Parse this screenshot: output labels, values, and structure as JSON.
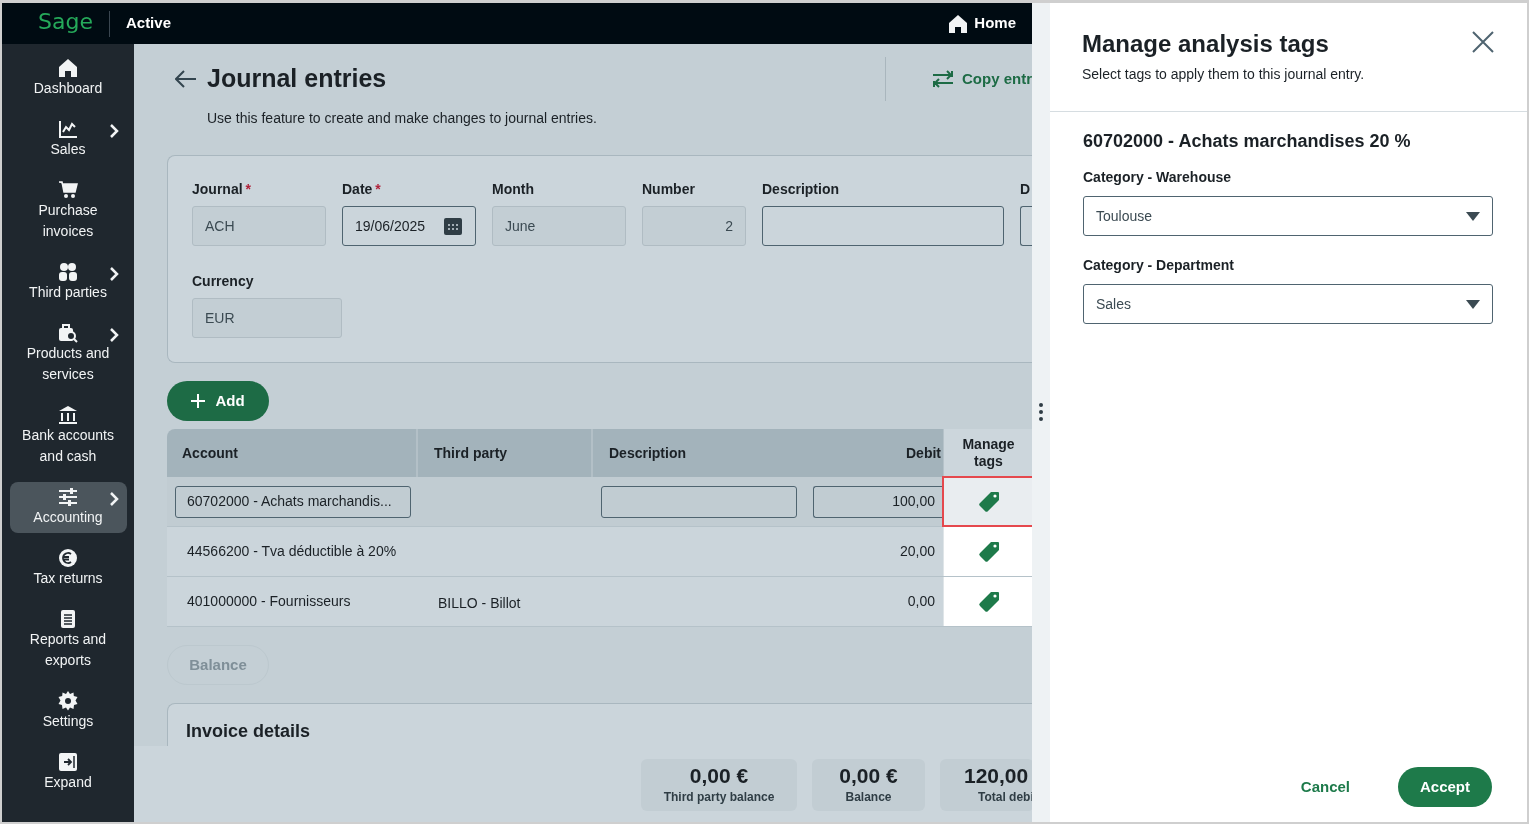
{
  "top_bar": {
    "logo": "Sage",
    "product": "Active",
    "home": "Home"
  },
  "sidebar": {
    "items": [
      {
        "label": "Dashboard",
        "kind": "home",
        "has_submenu": false,
        "selected": false
      },
      {
        "label": "Sales",
        "kind": "chart",
        "has_submenu": true,
        "selected": false
      },
      {
        "label": "Purchase invoices",
        "kind": "cart",
        "has_submenu": false,
        "selected": false
      },
      {
        "label": "Third parties",
        "kind": "people",
        "has_submenu": true,
        "selected": false
      },
      {
        "label": "Products and services",
        "kind": "products",
        "has_submenu": true,
        "selected": false
      },
      {
        "label": "Bank accounts and cash",
        "kind": "bank",
        "has_submenu": false,
        "selected": false
      },
      {
        "label": "Accounting",
        "kind": "sliders",
        "has_submenu": true,
        "selected": true
      },
      {
        "label": "Tax returns",
        "kind": "euro",
        "has_submenu": false,
        "selected": false
      },
      {
        "label": "Reports and exports",
        "kind": "report",
        "has_submenu": false,
        "selected": false
      },
      {
        "label": "Settings",
        "kind": "gear",
        "has_submenu": false,
        "selected": false
      },
      {
        "label": "Expand",
        "kind": "expand",
        "has_submenu": false,
        "selected": false
      }
    ]
  },
  "page": {
    "title": "Journal entries",
    "subtitle": "Use this feature to create and make changes to journal entries.",
    "copy_action": "Copy entr"
  },
  "form": {
    "rows": [
      [
        {
          "label": "Journal",
          "required_mark": "*",
          "value": "ACH",
          "kind": "readonly"
        },
        {
          "label": "Date",
          "required_mark": "*",
          "value": "19/06/2025",
          "kind": "date"
        },
        {
          "label": "Month",
          "value": "June",
          "kind": "readonly"
        },
        {
          "label": "Number",
          "value": "2",
          "kind": "number"
        },
        {
          "label": "Description",
          "kind": "input"
        },
        {
          "label": "D",
          "kind": "cut"
        }
      ],
      [
        {
          "label": "Currency",
          "value": "EUR",
          "kind": "currency"
        }
      ]
    ]
  },
  "add_button": "Add",
  "table": {
    "columns": [
      "Account",
      "Third party",
      "Description",
      "Debit",
      "Manage tags"
    ],
    "rows": [
      {
        "account": "60702000 - Achats marchandis...",
        "debit": "100,00",
        "selected": true
      },
      {
        "account": "44566200 - Tva déductible à 20%",
        "debit": "20,00",
        "selected": false
      },
      {
        "account": "401000000 - Fournisseurs",
        "third_party": "BILLO - Billot",
        "debit": "0,00",
        "selected": false
      }
    ]
  },
  "balance_button": {
    "label": "Balance",
    "disabled": true
  },
  "invoice_details": {
    "title": "Invoice details"
  },
  "totals": [
    {
      "amount": "0,00 €",
      "label": "Third party balance"
    },
    {
      "amount": "0,00 €",
      "label": "Balance"
    },
    {
      "amount": "120,00",
      "label": "Total debi"
    }
  ],
  "panel": {
    "title": "Manage analysis tags",
    "subtitle": "Select tags to apply them to this journal entry.",
    "account": "60702000 - Achats marchandises 20 %",
    "categories": [
      {
        "label": "Category - Warehouse",
        "value": "Toulouse"
      },
      {
        "label": "Category - Department",
        "value": "Sales"
      }
    ],
    "cancel": "Cancel",
    "accept": "Accept"
  }
}
